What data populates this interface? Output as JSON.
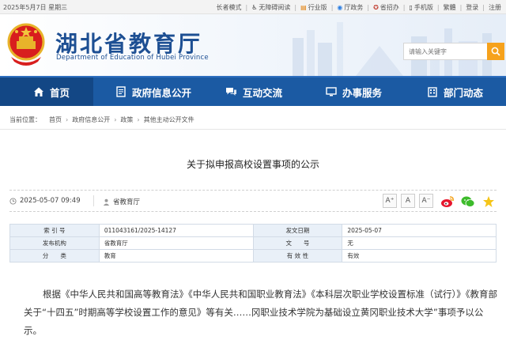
{
  "topbar": {
    "date": "2025年5月7日 星期三",
    "links": [
      {
        "label": "长者模式",
        "icon": ""
      },
      {
        "label": "无障碍阅读",
        "icon": "accessibility-icon"
      },
      {
        "label": "行业版",
        "icon": "industry-icon"
      },
      {
        "label": "厅政务",
        "icon": "gov-icon"
      },
      {
        "label": "省招办",
        "icon": "exam-office-icon"
      },
      {
        "label": "手机版",
        "icon": "mobile-icon"
      }
    ],
    "lang": "繁體",
    "login": "登录",
    "register": "注册"
  },
  "header": {
    "title": "湖北省教育厅",
    "subtitle": "Department of Education of Hubei Province",
    "search_placeholder": "请输入关键字"
  },
  "nav": [
    {
      "label": "首页",
      "icon": "home-icon"
    },
    {
      "label": "政府信息公开",
      "icon": "document-icon"
    },
    {
      "label": "互动交流",
      "icon": "chat-icon"
    },
    {
      "label": "办事服务",
      "icon": "monitor-icon"
    },
    {
      "label": "部门动态",
      "icon": "building-icon"
    }
  ],
  "breadcrumb": {
    "prefix": "当前位置：",
    "items": [
      "首页",
      "政府信息公开",
      "政策",
      "其他主动公开文件"
    ]
  },
  "article": {
    "title": "关于拟申报高校设置事项的公示",
    "publish_time": "2025-05-07 09:49",
    "source": "省教育厅",
    "font_buttons": [
      "A⁺",
      "A",
      "A⁻"
    ]
  },
  "info_table": [
    {
      "k1": "索 引 号",
      "v1": "011043161/2025-14127",
      "k2": "发文日期",
      "v2": "2025-05-07"
    },
    {
      "k1": "发布机构",
      "v1": "省教育厅",
      "k2": "文　　号",
      "v2": "无"
    },
    {
      "k1": "分　　类",
      "v1": "教育",
      "k2": "有 效 性",
      "v2": "有效"
    }
  ],
  "body": {
    "paragraph": "根据《中华人民共和国高等教育法》《中华人民共和国职业教育法》《本科层次职业学校设置标准（试行）》《教育部关于“十四五”时期高等学校设置工作的意见》等有关……冈职业技术学院为基础设立黄冈职业技术大学”事项予以公示。"
  },
  "colors": {
    "nav_bg": "#1b5aa3",
    "nav_active": "#134785",
    "title_blue": "#1d4f93",
    "search_btn": "#f6a21c",
    "table_key_bg": "#e9f0f8"
  }
}
